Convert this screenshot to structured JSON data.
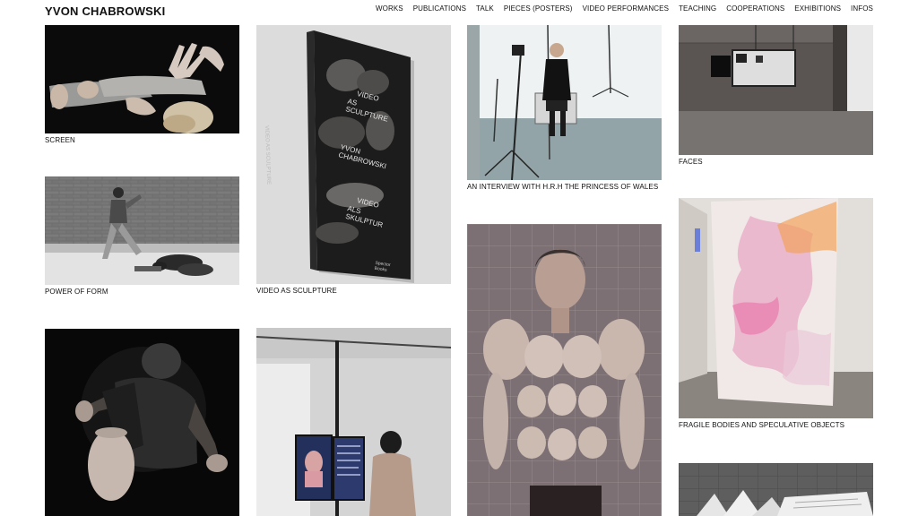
{
  "header": {
    "site_title": "YVON CHABROWSKI",
    "nav": [
      "WORKS",
      "PUBLICATIONS",
      "TALK",
      "PIECES (POSTERS)",
      "VIDEO PERFORMANCES",
      "TEACHING",
      "COOPERATIONS",
      "EXHIBITIONS",
      "INFOS"
    ]
  },
  "works": {
    "screen": "SCREEN",
    "power_of_form": "POWER OF FORM",
    "video_as_sculpture": "VIDEO AS SCULPTURE",
    "interview": "AN INTERVIEW WITH H.R.H THE PRINCESS OF WALES",
    "faces": "FACES",
    "fragile": "FRAGILE BODIES AND SPECULATIVE OBJECTS"
  },
  "book_cover": {
    "title_en_1": "VIDEO",
    "title_en_2": "AS SCULPTURE",
    "author": "YVON CHABROWSKI",
    "title_de_1": "VIDEO",
    "title_de_2": "ALS SKULPTUR",
    "spine": "VIDEO AS SCULPTURE",
    "publisher": "Spector Books"
  }
}
